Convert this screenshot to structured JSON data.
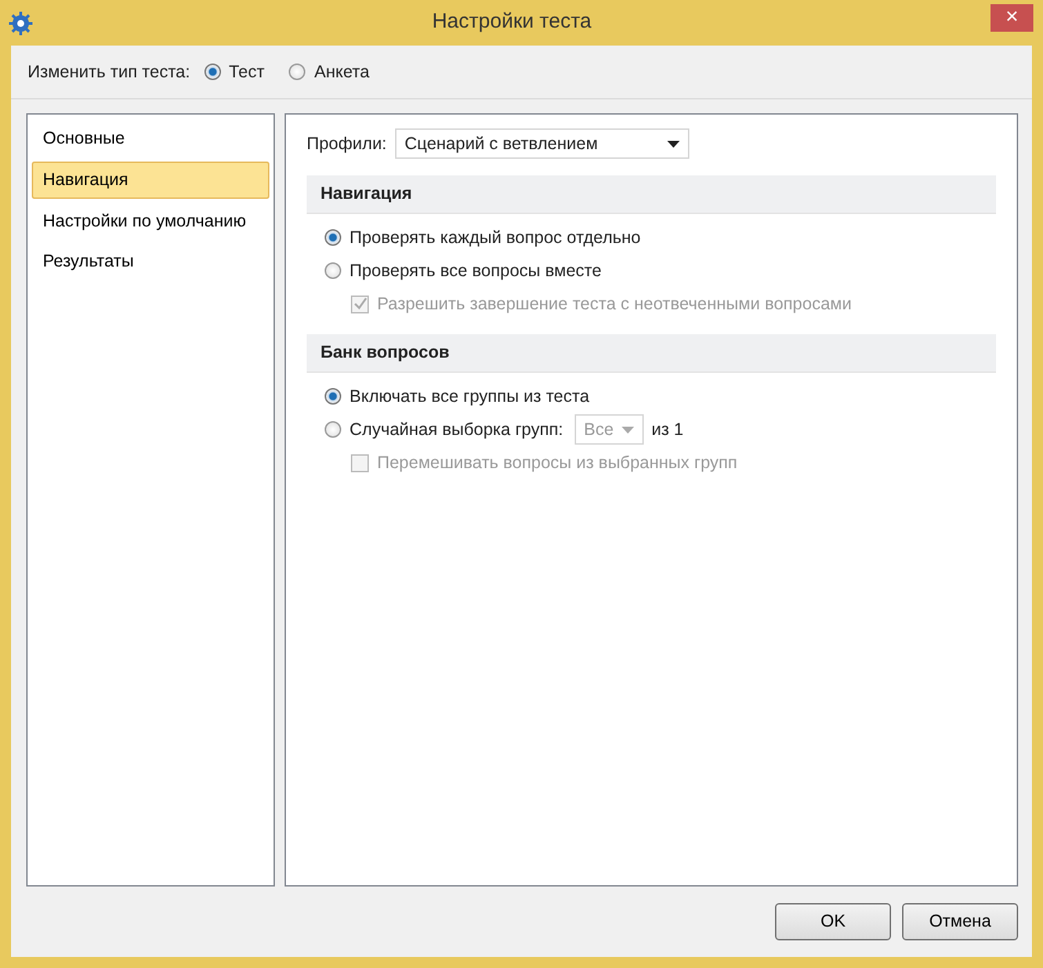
{
  "window": {
    "title": "Настройки теста",
    "close": "×"
  },
  "test_type": {
    "label": "Изменить тип теста:",
    "options": [
      {
        "label": "Тест",
        "selected": true
      },
      {
        "label": "Анкета",
        "selected": false
      }
    ]
  },
  "sidebar": {
    "items": [
      {
        "label": "Основные",
        "selected": false
      },
      {
        "label": "Навигация",
        "selected": true
      },
      {
        "label": "Настройки по умолчанию",
        "selected": false
      },
      {
        "label": "Результаты",
        "selected": false
      }
    ]
  },
  "profile": {
    "label": "Профили:",
    "value": "Сценарий с ветвлением"
  },
  "sections": [
    {
      "title": "Навигация",
      "options": [
        {
          "label": "Проверять каждый вопрос отдельно",
          "selected": true
        },
        {
          "label": "Проверять все вопросы вместе",
          "selected": false,
          "children": [
            {
              "label": "Разрешить завершение теста с неотвеченными вопросами",
              "checked": true,
              "disabled": true
            }
          ]
        }
      ]
    },
    {
      "title": "Банк вопросов",
      "options": [
        {
          "label": "Включать все группы из теста",
          "selected": true
        },
        {
          "label": "Случайная выборка групп:",
          "selected": false,
          "select": {
            "value": "Все",
            "disabled": true
          },
          "suffix": "из 1",
          "children": [
            {
              "label": "Перемешивать вопросы из выбранных групп",
              "checked": false,
              "disabled": true
            }
          ]
        }
      ]
    }
  ],
  "buttons": [
    "OK",
    "Отмена"
  ]
}
